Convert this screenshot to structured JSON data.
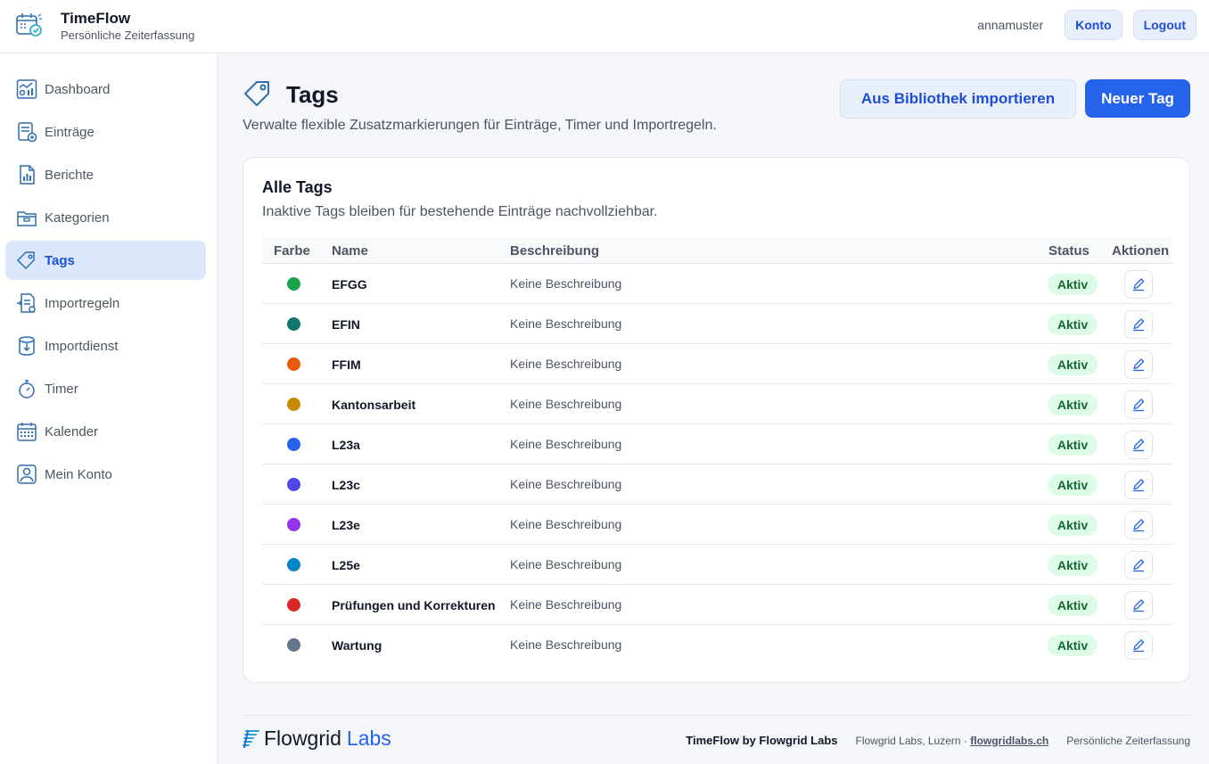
{
  "app": {
    "title": "TimeFlow",
    "subtitle": "Persönliche Zeiterfassung",
    "icon": "calendar-check-icon"
  },
  "topbar": {
    "username": "annamuster",
    "account_label": "Konto",
    "logout_label": "Logout"
  },
  "sidebar": {
    "items": [
      {
        "label": "Dashboard",
        "icon": "dashboard-icon",
        "active": false
      },
      {
        "label": "Einträge",
        "icon": "entries-icon",
        "active": false
      },
      {
        "label": "Berichte",
        "icon": "report-icon",
        "active": false
      },
      {
        "label": "Kategorien",
        "icon": "folder-icon",
        "active": false
      },
      {
        "label": "Tags",
        "icon": "tag-icon",
        "active": true
      },
      {
        "label": "Importregeln",
        "icon": "import-rules-icon",
        "active": false
      },
      {
        "label": "Importdienst",
        "icon": "import-service-icon",
        "active": false
      },
      {
        "label": "Timer",
        "icon": "stopwatch-icon",
        "active": false
      },
      {
        "label": "Kalender",
        "icon": "calendar-icon",
        "active": false
      },
      {
        "label": "Mein Konto",
        "icon": "user-icon",
        "active": false
      }
    ]
  },
  "page": {
    "title": "Tags",
    "subtitle": "Verwalte flexible Zusatzmarkierungen für Einträge, Timer und Importregeln.",
    "import_label": "Aus Bibliothek importieren",
    "new_label": "Neuer Tag"
  },
  "card": {
    "title": "Alle Tags",
    "subtitle": "Inaktive Tags bleiben für bestehende Einträge nachvollziehbar."
  },
  "table": {
    "columns": {
      "color": "Farbe",
      "name": "Name",
      "description": "Beschreibung",
      "status": "Status",
      "actions": "Aktionen"
    },
    "rows": [
      {
        "color": "#16a34a",
        "name": "EFGG",
        "description": "Keine Beschreibung",
        "status": "Aktiv"
      },
      {
        "color": "#0f766e",
        "name": "EFIN",
        "description": "Keine Beschreibung",
        "status": "Aktiv"
      },
      {
        "color": "#ea580c",
        "name": "FFIM",
        "description": "Keine Beschreibung",
        "status": "Aktiv"
      },
      {
        "color": "#ca8a04",
        "name": "Kantonsarbeit",
        "description": "Keine Beschreibung",
        "status": "Aktiv"
      },
      {
        "color": "#2563eb",
        "name": "L23a",
        "description": "Keine Beschreibung",
        "status": "Aktiv"
      },
      {
        "color": "#4f46e5",
        "name": "L23c",
        "description": "Keine Beschreibung",
        "status": "Aktiv"
      },
      {
        "color": "#9333ea",
        "name": "L23e",
        "description": "Keine Beschreibung",
        "status": "Aktiv"
      },
      {
        "color": "#0284c7",
        "name": "L25e",
        "description": "Keine Beschreibung",
        "status": "Aktiv"
      },
      {
        "color": "#dc2626",
        "name": "Prüfungen und Korrekturen",
        "description": "Keine Beschreibung",
        "status": "Aktiv"
      },
      {
        "color": "#64748b",
        "name": "Wartung",
        "description": "Keine Beschreibung",
        "status": "Aktiv"
      }
    ]
  },
  "footer": {
    "logo_word": "Flowgrid",
    "logo_accent": "Labs",
    "product": "TimeFlow by Flowgrid Labs",
    "location": "Flowgrid Labs, Luzern ·",
    "link": "flowgridlabs.ch",
    "tagline": "Persönliche Zeiterfassung"
  },
  "colors": {
    "accent": "#2563eb",
    "active_bg": "#dbe7fc",
    "badge_bg": "#dcfce7",
    "badge_text": "#166534"
  }
}
